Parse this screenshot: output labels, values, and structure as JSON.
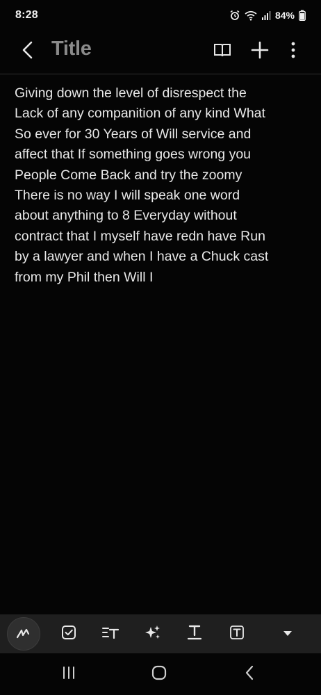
{
  "status_bar": {
    "time": "8:28",
    "battery": "84%",
    "icons": [
      "alarm-icon",
      "wifi-icon",
      "signal-icon",
      "battery-icon"
    ]
  },
  "header": {
    "title": "Title",
    "icons": [
      "back-icon",
      "reading-mode-icon",
      "add-icon",
      "more-icon"
    ]
  },
  "note": {
    "body": "Giving down the level of disrespect the\nLack of any companition of any kind What\nSo ever for 30 Years of Will service and\naffect that If something goes wrong you\nPeople Come Back and try the zoomy\nThere is no way I will speak one word\nabout anything to 8 Everyday without\ncontract that I myself have redn have Run\nby a lawyer and when I have a Chuck cast\nfrom my Phil then Will I"
  },
  "toolbar": {
    "icons": [
      "pen-icon",
      "checkbox-icon",
      "text-style-icon",
      "ai-sparkle-icon",
      "text-underline-icon",
      "text-box-icon",
      "expand-toolbar-icon"
    ],
    "colors": {
      "background": "#1f1f1f",
      "active_button": "#2f2f2f"
    }
  },
  "navbar": {
    "icons": [
      "recents-icon",
      "home-icon",
      "nav-back-icon"
    ]
  },
  "colors": {
    "background": "#050505",
    "text": "#e8e8e8",
    "title": "#8a8a8a"
  }
}
